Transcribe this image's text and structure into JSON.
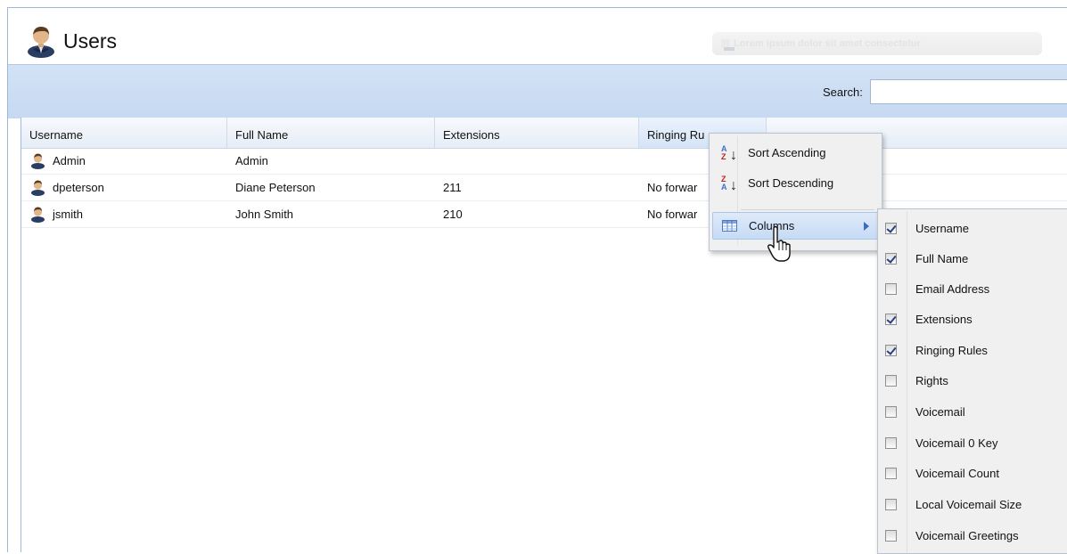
{
  "header": {
    "title": "Users",
    "faded_hint": "Lorem ipsum dolor sit amet consectetur"
  },
  "search": {
    "label": "Search:",
    "value": ""
  },
  "grid": {
    "columns": [
      "Username",
      "Full Name",
      "Extensions",
      "Ringing Ru"
    ],
    "rows": [
      {
        "username": "Admin",
        "full_name": "Admin",
        "extensions": "",
        "ringing": ""
      },
      {
        "username": "dpeterson",
        "full_name": "Diane Peterson",
        "extensions": "211",
        "ringing": "No forwar"
      },
      {
        "username": "jsmith",
        "full_name": "John Smith",
        "extensions": "210",
        "ringing": "No forwar"
      }
    ]
  },
  "context_menu": {
    "items": [
      {
        "label": "Sort Ascending",
        "icon": "sort-ascending-icon"
      },
      {
        "label": "Sort Descending",
        "icon": "sort-descending-icon"
      },
      {
        "label": "Columns",
        "icon": "columns-icon",
        "highlighted": true
      }
    ]
  },
  "columns_submenu": {
    "items": [
      {
        "label": "Username",
        "checked": true
      },
      {
        "label": "Full Name",
        "checked": true
      },
      {
        "label": "Email Address",
        "checked": false
      },
      {
        "label": "Extensions",
        "checked": true
      },
      {
        "label": "Ringing Rules",
        "checked": true
      },
      {
        "label": "Rights",
        "checked": false
      },
      {
        "label": "Voicemail",
        "checked": false
      },
      {
        "label": "Voicemail 0 Key",
        "checked": false
      },
      {
        "label": "Voicemail Count",
        "checked": false
      },
      {
        "label": "Local Voicemail Size",
        "checked": false
      },
      {
        "label": "Voicemail Greetings",
        "checked": false
      }
    ]
  },
  "colors": {
    "header_band": "#c6d9f2",
    "grid_border": "#99bbe8",
    "menu_bg": "#f0f0f0",
    "highlight": "#c6dbf5"
  }
}
